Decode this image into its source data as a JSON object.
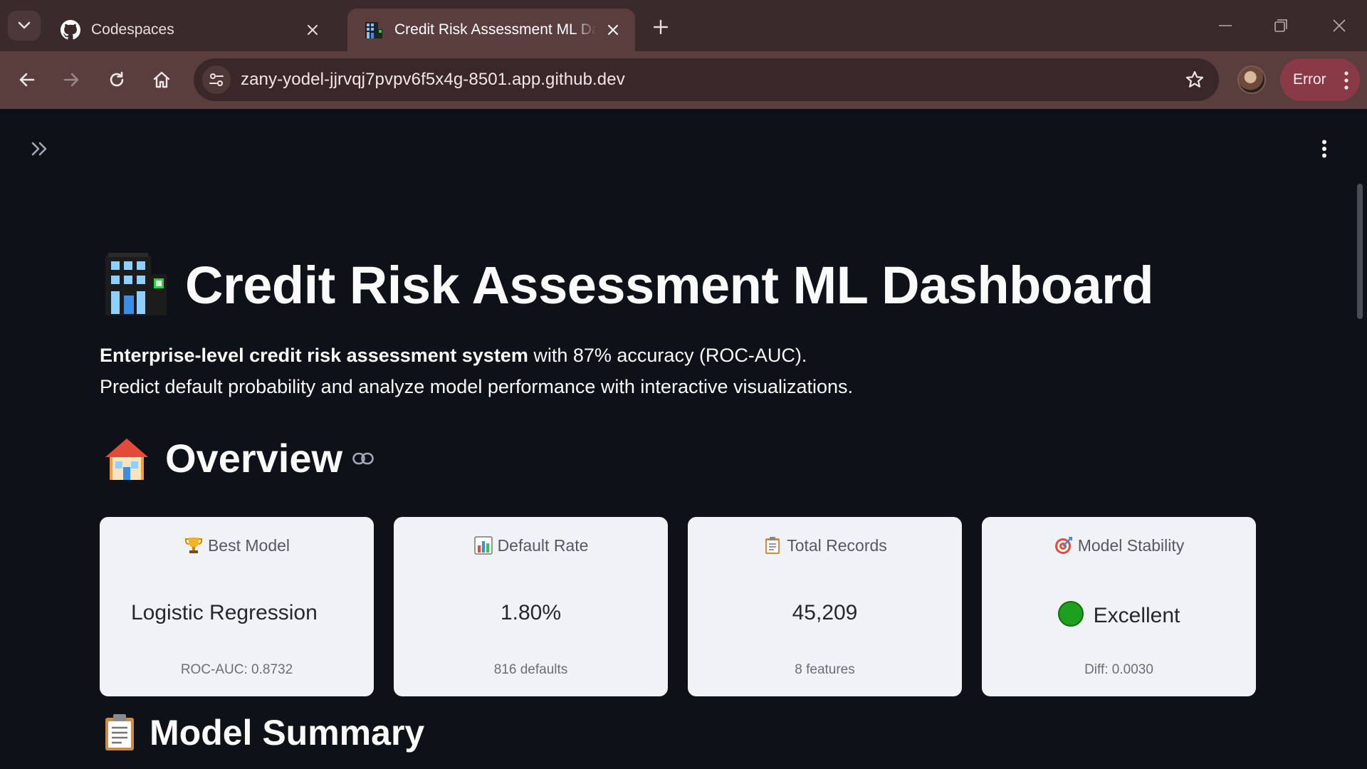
{
  "browser": {
    "tabs": [
      {
        "title": "Codespaces",
        "favicon": "github-icon",
        "active": false
      },
      {
        "title": "Credit Risk Assessment ML Dashboard",
        "favicon": "office-building-icon",
        "active": true
      }
    ],
    "url": "zany-yodel-jjrvqj7pvpv6f5x4g-8501.app.github.dev",
    "profile_button_label": "Error"
  },
  "page": {
    "title": "Credit Risk Assessment ML Dashboard",
    "title_icon": "office-building-icon",
    "intro": {
      "bold": "Enterprise-level credit risk assessment system",
      "rest": " with 87% accuracy (ROC-AUC).",
      "line2": "Predict default probability and analyze model performance with interactive visualizations."
    },
    "overview": {
      "title": "Overview",
      "icon": "house-icon",
      "cards": [
        {
          "icon": "trophy-icon",
          "label": "Best Model",
          "value": "Logistic Regression",
          "sub": "ROC-AUC: 0.8732"
        },
        {
          "icon": "bar-chart-icon",
          "label": "Default Rate",
          "value": "1.80%",
          "sub": "816 defaults"
        },
        {
          "icon": "clipboard-icon",
          "label": "Total Records",
          "value": "45,209",
          "sub": "8 features"
        },
        {
          "icon": "target-icon",
          "label": "Model Stability",
          "value": "Excellent",
          "sub": "Diff: 0.0030",
          "status_color": "#1ea01e"
        }
      ]
    },
    "model_summary": {
      "title": "Model Summary",
      "icon": "clipboard-icon"
    }
  }
}
